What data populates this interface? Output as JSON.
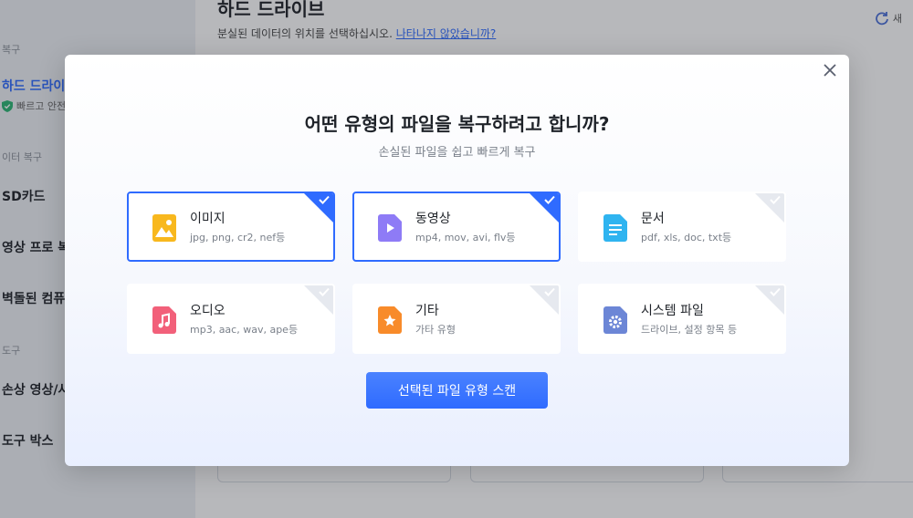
{
  "sidebar": {
    "section_recover": "복구",
    "hard_drive": "하드 드라이브",
    "hard_drive_sub": "빠르고 안전",
    "section_data_recover": "이터 복구",
    "sd_card": "SD카드",
    "video_pro": "영상 프로 복구",
    "crashed_pc": "벽돌된 컴퓨터",
    "section_tools": "도구",
    "damaged_video": "손상 영상/사진",
    "toolbox": "도구 박스"
  },
  "main": {
    "title": "하드 드라이브",
    "subtitle": "분실된 데이터의 위치를 선택하십시오.",
    "link": "나타나지 않았습니까?",
    "refresh": "새"
  },
  "modal": {
    "title": "어떤 유형의 파일을 복구하려고 합니까?",
    "subtitle": "손실된 파일을 쉽고 빠르게 복구",
    "scan_button": "선택된 파일 유형 스캔",
    "file_types": [
      {
        "name": "이미지",
        "ext": "jpg, png, cr2, nef등",
        "selected": true,
        "icon": "image-file-icon",
        "color": "#f8b81e"
      },
      {
        "name": "동영상",
        "ext": "mp4, mov, avi, flv등",
        "selected": true,
        "icon": "video-file-icon",
        "color": "#8e7bf6"
      },
      {
        "name": "문서",
        "ext": "pdf, xls, doc, txt등",
        "selected": false,
        "icon": "document-file-icon",
        "color": "#2fb4f0"
      },
      {
        "name": "오디오",
        "ext": "mp3, aac, wav, ape등",
        "selected": false,
        "icon": "audio-file-icon",
        "color": "#f2607a"
      },
      {
        "name": "기타",
        "ext": "가타 유형",
        "selected": false,
        "icon": "other-file-icon",
        "color": "#f88b2a"
      },
      {
        "name": "시스템 파일",
        "ext": "드라이브, 설정 항목 등",
        "selected": false,
        "icon": "system-file-icon",
        "color": "#6c86d6"
      }
    ]
  }
}
